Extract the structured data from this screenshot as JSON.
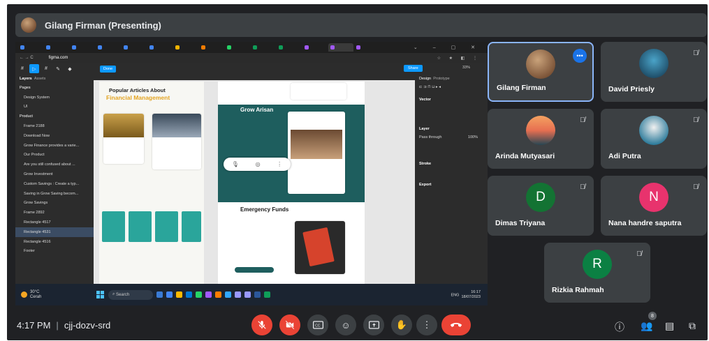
{
  "meeting": {
    "presenter_banner": "Gilang Firman (Presenting)",
    "time": "4:17 PM",
    "separator": "|",
    "meeting_code": "cjj-dozv-srd",
    "participants_count": "8"
  },
  "participants": [
    {
      "name": "Gilang Firman",
      "initial": "",
      "muted": false,
      "speaking": true
    },
    {
      "name": "David Priesly",
      "initial": "",
      "muted": true
    },
    {
      "name": "Arinda Mutyasari",
      "initial": "",
      "muted": true
    },
    {
      "name": "Adi Putra",
      "initial": "",
      "muted": true
    },
    {
      "name": "Dimas Triyana",
      "initial": "D",
      "muted": true,
      "color": "#137333"
    },
    {
      "name": "Nana handre saputra",
      "initial": "N",
      "muted": true,
      "color": "#e8336d"
    },
    {
      "name": "Rizkia Rahmah",
      "initial": "R",
      "muted": true,
      "color": "#0b8043"
    }
  ],
  "shared_screen": {
    "browser_url_host": "figma.com",
    "figma": {
      "layers_tab": "Layers",
      "assets_tab": "Assets",
      "pages_label": "Pages",
      "pages": [
        "Design System",
        "UI"
      ],
      "product_label": "Product",
      "layers": [
        "Frame 2188",
        "Download Now",
        "Grow Finance provides a varie...",
        "Our Product",
        "Are you still confused about ...",
        "Grow Investment",
        "Custom Savings : Create a typ...",
        "Saving in Grow Saving becom...",
        "Grow Savings",
        "Frame 2892",
        "Rectangle 4517",
        "Rectangle 4531",
        "Rectangle 4516",
        "Footer"
      ],
      "done_label": "Done",
      "share_label": "Share",
      "zoom": "33%",
      "design_tab": "Design",
      "prototype_tab": "Prototype",
      "vector_label": "Vector",
      "layer_label": "Layer",
      "pass_through": "Pass through",
      "opacity": "100%",
      "stroke_label": "Stroke",
      "export_label": "Export",
      "popular_title_line1": "Popular Articles About",
      "popular_title_line2": "Financial Management",
      "grow_arisan": "Grow Arisan",
      "emergency_funds": "Emergency Funds"
    },
    "taskbar": {
      "weather_temp": "30°C",
      "weather_desc": "Cerah",
      "search": "Search",
      "lang": "ENG",
      "clock_time": "16:17",
      "clock_date": "18/07/2023"
    }
  },
  "colors": {
    "meet_bg": "#202124",
    "tile_bg": "#3c4043",
    "end_call": "#ea4335",
    "figma_blue": "#0d99ff",
    "teal": "#1e5e5e"
  },
  "icons": [
    "mic-off-icon",
    "camera-off-icon",
    "captions-icon",
    "emoji-icon",
    "present-icon",
    "raise-hand-icon",
    "more-options-icon",
    "end-call-icon",
    "info-icon",
    "people-icon",
    "chat-icon",
    "activities-icon"
  ]
}
